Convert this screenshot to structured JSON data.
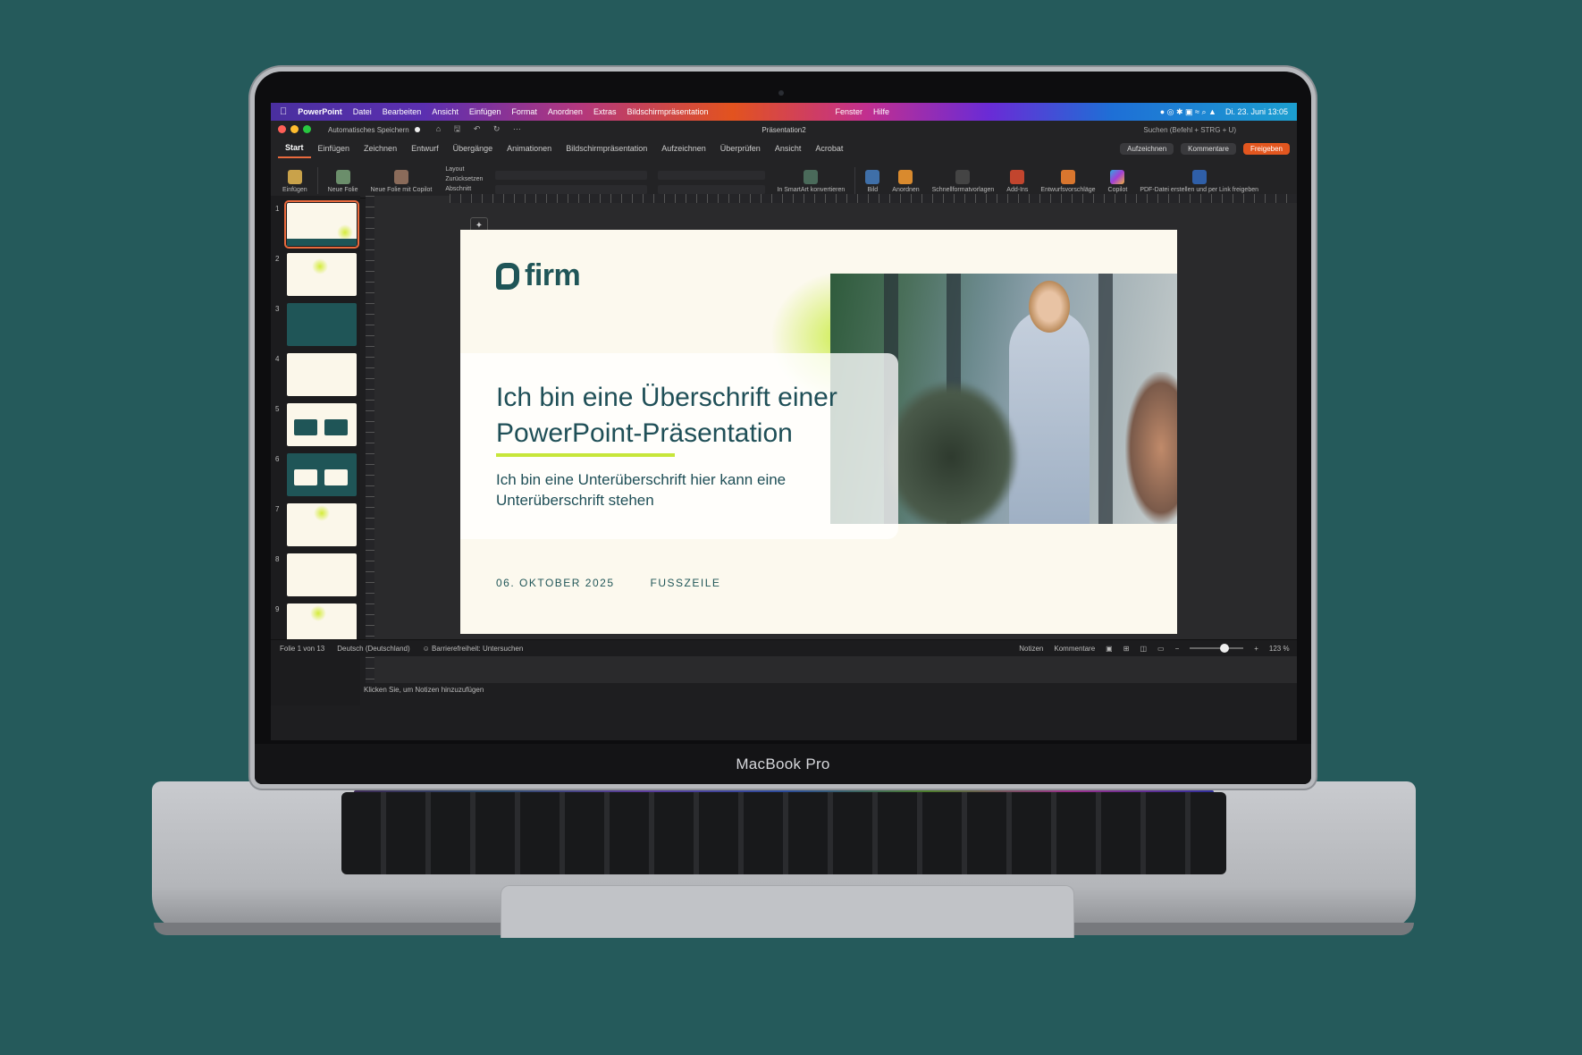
{
  "device": {
    "label": "MacBook Pro"
  },
  "menubar": {
    "apple_icon": "apple-icon",
    "items": [
      "PowerPoint",
      "Datei",
      "Bearbeiten",
      "Ansicht",
      "Einfügen",
      "Format",
      "Anordnen",
      "Extras",
      "Bildschirmpräsentation",
      "Fenster",
      "Hilfe"
    ],
    "datetime": "Di. 23. Juni 13:05"
  },
  "titlebar": {
    "autosave": "Automatisches Speichern",
    "doc_title": "Präsentation2",
    "search_placeholder": "Suchen (Befehl + STRG + U)"
  },
  "ribbon_tabs": [
    "Start",
    "Einfügen",
    "Zeichnen",
    "Entwurf",
    "Übergänge",
    "Animationen",
    "Bildschirmpräsentation",
    "Aufzeichnen",
    "Überprüfen",
    "Ansicht",
    "Acrobat"
  ],
  "actions": {
    "record": "Aufzeichnen",
    "comments": "Kommentare",
    "share": "Freigeben"
  },
  "ribbon": {
    "paste": "Einfügen",
    "new_slide": "Neue Folie",
    "new_slide_copilot": "Neue Folie mit Copilot",
    "layout": "Layout",
    "reset": "Zurücksetzen",
    "section": "Abschnitt",
    "smartart": "In SmartArt konvertieren",
    "picture": "Bild",
    "arrange": "Anordnen",
    "quick_styles": "Schnellformatvorlagen",
    "addins": "Add-Ins",
    "designer": "Entwurfsvorschläge",
    "copilot": "Copilot",
    "pdf": "PDF-Datei erstellen und per Link freigeben"
  },
  "thumbnails": [
    "1",
    "2",
    "3",
    "4",
    "5",
    "6",
    "7",
    "8",
    "9"
  ],
  "slide": {
    "logo": "firm",
    "title": "Ich bin eine Überschrift einer PowerPoint-Präsentation",
    "subtitle": "Ich bin eine Unterüberschrift hier kann eine Unterüberschrift stehen",
    "date": "06. OKTOBER 2025",
    "footer": "FUSSZEILE"
  },
  "notes_placeholder": "Klicken Sie, um Notizen hinzuzufügen",
  "statusbar": {
    "slide_count": "Folie 1 von 13",
    "language": "Deutsch (Deutschland)",
    "accessibility": "Barrierefreiheit: Untersuchen",
    "notes": "Notizen",
    "comments": "Kommentare",
    "zoom": "123 %"
  },
  "colors": {
    "background": "#255a5b",
    "brand_teal": "#1f5557",
    "accent_lime": "#c7e63a",
    "share_orange": "#e2561f"
  }
}
